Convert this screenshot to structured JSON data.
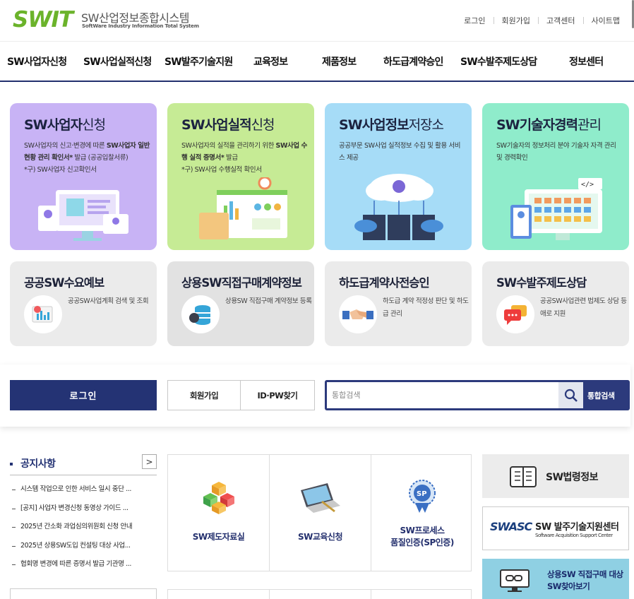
{
  "header": {
    "logo_mark": "SWIT",
    "logo_title": "SW산업정보종합시스템",
    "logo_sub": "SoftWare Industry Information Total System",
    "util_menu": [
      "로그인",
      "회원가입",
      "고객센터",
      "사이트맵"
    ]
  },
  "gnb": [
    "SW사업자신청",
    "SW사업실적신청",
    "SW발주기술지원",
    "교육정보",
    "제품정보",
    "하도급계약승인",
    "SW수발주제도상담",
    "정보센터"
  ],
  "cards": [
    {
      "title_bold": "SW사업자",
      "title_rest": "신청",
      "desc_1": "SW사업자의 신고·변경에 따른 ",
      "desc_bold": "SW사업자 일반 현황 관리 확인서*",
      "desc_2": " 발급 (공공입찰서류)",
      "desc_3": "*구) SW사업자 신고확인서",
      "color": "#c8b3f5"
    },
    {
      "title_bold": "SW사업실적",
      "title_rest": "신청",
      "desc_1": "SW사업자의 실적을 관리하기 위한 ",
      "desc_bold": "SW사업 수행 실적 증명서*",
      "desc_2": " 발급",
      "desc_3": "*구) SW사업 수행실적 확인서",
      "color": "#c6eb95"
    },
    {
      "title_bold": "SW사업정보",
      "title_rest": "저장소",
      "desc_1": "공공부문 SW사업 실적정보 수집 및 활용 서비스 제공",
      "desc_bold": "",
      "desc_2": "",
      "desc_3": "",
      "color": "#a6dcf7"
    },
    {
      "title_bold": "SW기술자경력",
      "title_rest": "관리",
      "desc_1": "SW기술자의 정보처리 분야 기술자 자격 관리 및 경력확인",
      "desc_bold": "",
      "desc_2": "",
      "desc_3": "",
      "color": "#8feccb"
    }
  ],
  "gray_cards": [
    {
      "title": "공공SW수요예보",
      "desc": "공공SW사업계획 검색 및 조회",
      "icon": "chart-report-icon"
    },
    {
      "title": "상용SW직접구매계약정보",
      "desc": "상용SW 직접구매 계약정보 등록",
      "icon": "database-icon"
    },
    {
      "title": "하도급계약사전승인",
      "desc": "하도급 계약 적정성 판단 및 하도급 관리",
      "icon": "handshake-icon"
    },
    {
      "title": "SW수발주제도상담",
      "desc": "공공SW사업관련 법제도 상담 등 애로 지원",
      "icon": "chat-bubble-icon"
    }
  ],
  "band": {
    "login": "로그인",
    "join": "회원가입",
    "idpw": "ID·PW찾기",
    "search_placeholder": "통합검색",
    "search_label": "통합검색"
  },
  "notice": {
    "title": "공지사항",
    "more": ">",
    "items": [
      "시스템 작업으로 인한 서비스 일시 중단 ...",
      "[공지] 사업자 변경신청 동영상 가이드 ...",
      "2025년 간소화 과업심의위원회 신청 안내",
      "2025년 상용SW도입 컨설팅 대상 사업...",
      "협회명 변경에 따른 증명서 발급 기관명 ..."
    ]
  },
  "quick": [
    {
      "label_1": "SW제도자료실",
      "label_2": "",
      "icon": "cubes-icon"
    },
    {
      "label_1": "SW교육신청",
      "label_2": "",
      "icon": "laptop-icon"
    },
    {
      "label_1": "SW프로세스",
      "label_2": "품질인증(SP인증)",
      "icon": "sp-badge-icon"
    }
  ],
  "right_banners": {
    "law": "SW법령정보",
    "swasc_logo": "SWASC",
    "swasc_title": "SW 발주기술지원센터",
    "swasc_sub": "Software Acquisition Support Center",
    "purchase_1": "상용SW 직접구매 대상",
    "purchase_2": "SW찾아보기"
  }
}
